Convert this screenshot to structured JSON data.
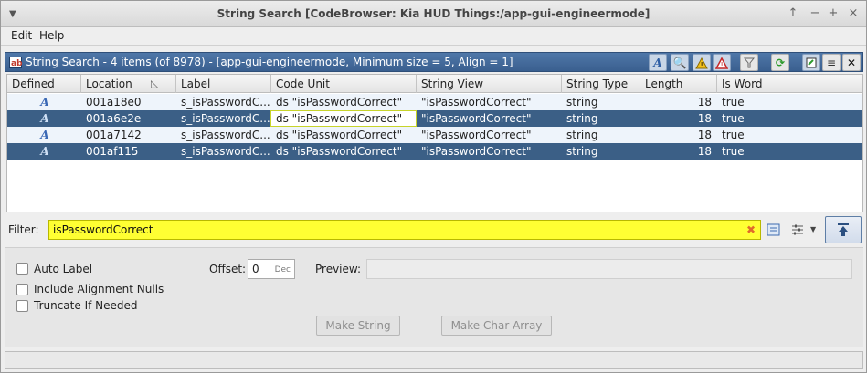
{
  "window": {
    "title": "String Search [CodeBrowser: Kia HUD Things:/app-gui-engineermode]"
  },
  "menubar": {
    "edit_label": "Edit",
    "help_label": "Help"
  },
  "panel": {
    "title": "String Search - 4 items (of 8978) - [app-gui-engineermode, Minimum size = 5, Align = 1]"
  },
  "table": {
    "columns": [
      "Defined",
      "Location",
      "Label",
      "Code Unit",
      "String View",
      "String Type",
      "Length",
      "Is Word"
    ],
    "rows": [
      {
        "location": "001a18e0",
        "label": "s_isPasswordC...",
        "code_unit": "ds \"isPasswordCorrect\"",
        "string_view": "\"isPasswordCorrect\"",
        "string_type": "string",
        "length": "18",
        "is_word": "true",
        "selected": false
      },
      {
        "location": "001a6e2e",
        "label": "s_isPasswordC...",
        "code_unit": "ds \"isPasswordCorrect\"",
        "string_view": "\"isPasswordCorrect\"",
        "string_type": "string",
        "length": "18",
        "is_word": "true",
        "selected": true
      },
      {
        "location": "001a7142",
        "label": "s_isPasswordC...",
        "code_unit": "ds \"isPasswordCorrect\"",
        "string_view": "\"isPasswordCorrect\"",
        "string_type": "string",
        "length": "18",
        "is_word": "true",
        "selected": false
      },
      {
        "location": "001af115",
        "label": "s_isPasswordC...",
        "code_unit": "ds \"isPasswordCorrect\"",
        "string_view": "\"isPasswordCorrect\"",
        "string_type": "string",
        "length": "18",
        "is_word": "true",
        "selected": true
      }
    ]
  },
  "filter": {
    "label": "Filter:",
    "value": "isPasswordCorrect"
  },
  "options": {
    "auto_label": "Auto Label",
    "include_alignment_nulls": "Include Alignment Nulls",
    "truncate_if_needed": "Truncate If Needed",
    "offset_label": "Offset:",
    "offset_value": "0",
    "offset_unit": "Dec",
    "preview_label": "Preview:",
    "make_string_label": "Make String",
    "make_char_array_label": "Make Char Array"
  },
  "colors": {
    "selection": "#3b5f86",
    "filter_highlight": "#ffff33",
    "header_blue": "#3a5f8f"
  }
}
